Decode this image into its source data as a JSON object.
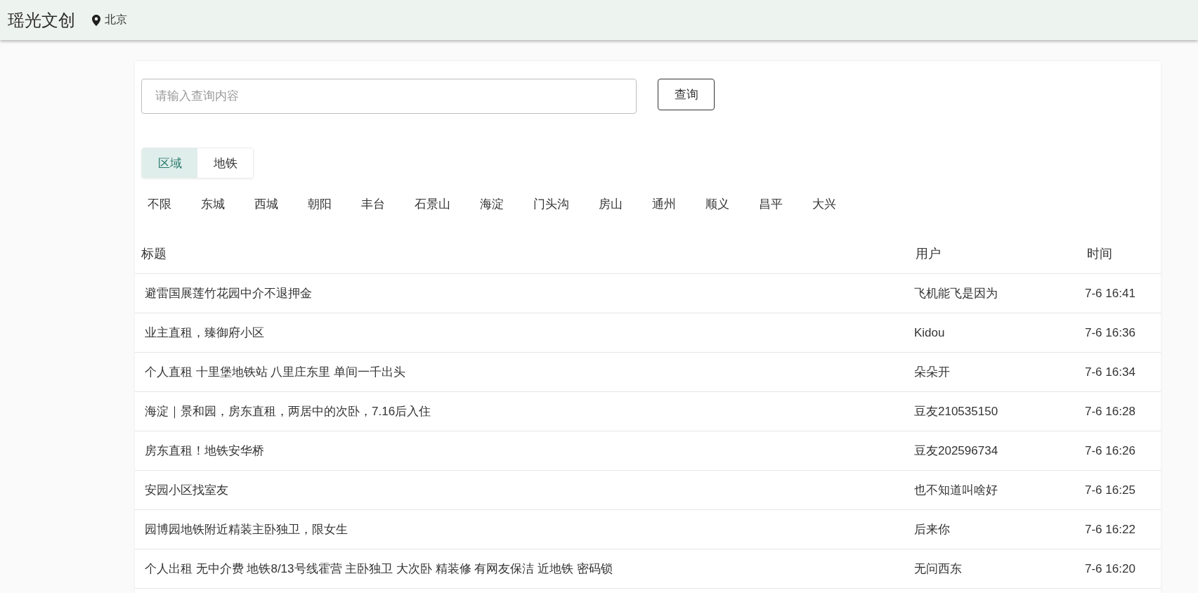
{
  "header": {
    "title": "瑶光文创",
    "location": "北京"
  },
  "search": {
    "placeholder": "请输入查询内容",
    "button": "查询"
  },
  "filter_tabs": [
    {
      "label": "区域",
      "selected": true
    },
    {
      "label": "地铁",
      "selected": false
    }
  ],
  "districts": [
    "不限",
    "东城",
    "西城",
    "朝阳",
    "丰台",
    "石景山",
    "海淀",
    "门头沟",
    "房山",
    "通州",
    "顺义",
    "昌平",
    "大兴"
  ],
  "table": {
    "columns": [
      "标题",
      "用户",
      "时间"
    ],
    "rows": [
      {
        "title": "避雷国展莲竹花园中介不退押金",
        "user": "飞机能飞是因为",
        "time": "7-6 16:41"
      },
      {
        "title": "业主直租，臻御府小区",
        "user": "Kidou",
        "time": "7-6 16:36"
      },
      {
        "title": "个人直租 十里堡地铁站 八里庄东里 单间一千出头",
        "user": "朵朵开",
        "time": "7-6 16:34"
      },
      {
        "title": "海淀｜景和园，房东直租，两居中的次卧，7.16后入住",
        "user": "豆友210535150",
        "time": "7-6 16:28"
      },
      {
        "title": "房东直租！地铁安华桥",
        "user": "豆友202596734",
        "time": "7-6 16:26"
      },
      {
        "title": "安园小区找室友",
        "user": "也不知道叫啥好",
        "time": "7-6 16:25"
      },
      {
        "title": "园博园地铁附近精装主卧独卫，限女生",
        "user": "后来你",
        "time": "7-6 16:22"
      },
      {
        "title": "个人出租 无中介费 地铁8/13号线霍营 主卧独卫 大次卧 精装修 有网友保洁 近地铁 密码锁",
        "user": "无问西东",
        "time": "7-6 16:20"
      }
    ]
  }
}
